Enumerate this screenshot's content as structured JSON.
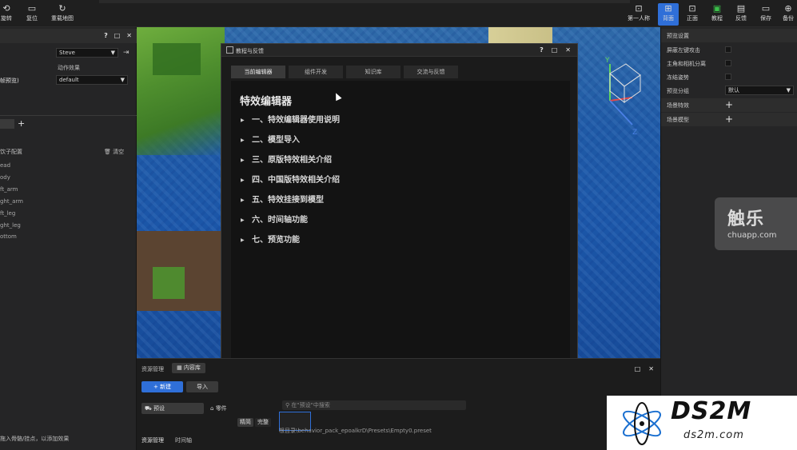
{
  "toolbar": {
    "left_buttons": [
      {
        "label": "旋转",
        "icon": "rotate-icon"
      },
      {
        "label": "复位",
        "icon": "reset-icon"
      },
      {
        "label": "重载地图",
        "icon": "reload-map-icon"
      }
    ],
    "right_buttons": [
      {
        "label": "第一人称",
        "icon": "first-person-icon"
      },
      {
        "label": "背面",
        "icon": "back-view-icon",
        "active": true
      },
      {
        "label": "正面",
        "icon": "front-view-icon"
      },
      {
        "label": "教程",
        "icon": "tutorial-icon"
      },
      {
        "label": "反馈",
        "icon": "feedback-icon"
      },
      {
        "label": "保存",
        "icon": "save-icon"
      },
      {
        "label": "备份",
        "icon": "backup-icon"
      }
    ]
  },
  "left_panel": {
    "controls": [
      "?",
      "□",
      "✕"
    ],
    "model_select": "Steve",
    "anim_effect_label": "动作效果",
    "preview_label": "帧预览)",
    "anim_select": "default",
    "bind_config_label": "饮子配置",
    "clear_label": "清空",
    "bones": [
      "ead",
      "ody",
      "ft_arm",
      "ght_arm",
      "ft_leg",
      "ght_leg",
      "ottom"
    ],
    "hint": "拖入骨骼/挂点，以添加效果"
  },
  "modal": {
    "title": "教程与反馈",
    "controls": [
      "?",
      "□",
      "✕"
    ],
    "tabs": [
      "当前编辑器",
      "组件开发",
      "知识库",
      "交流与反馈"
    ],
    "active_tab": 0,
    "doc_title": "特效编辑器",
    "toc": [
      "一、特效编辑器使用说明",
      "二、模型导入",
      "三、原版特效相关介绍",
      "四、中国版特效相关介绍",
      "五、特效挂接到模型",
      "六、时间轴功能",
      "七、预览功能"
    ]
  },
  "right_panel": {
    "section_title": "预览设置",
    "rows": [
      {
        "label": "屏蔽左键攻击",
        "type": "checkbox"
      },
      {
        "label": "主角和相机分离",
        "type": "checkbox"
      },
      {
        "label": "冻结姿势",
        "type": "checkbox"
      },
      {
        "label": "预览分组",
        "type": "select",
        "value": "默认"
      },
      {
        "label": "场景特效",
        "type": "add"
      },
      {
        "label": "场景模型",
        "type": "add"
      }
    ]
  },
  "bottom_dock": {
    "resource_label": "资源管理",
    "content_lib": "内容库",
    "new_button": "+ 新建",
    "import_button": "导入",
    "preset_item": "预设",
    "part_item": "零件",
    "search_placeholder": "在\"预设\"中搜索",
    "filter_tabs": [
      "精简",
      "完整"
    ],
    "path_text": "根目录\\behavior_pack_epoalkrD\\Presets\\Empty0.preset",
    "bottom_tabs": [
      "资源管理",
      "时间轴"
    ],
    "controls": [
      "□",
      "✕"
    ]
  },
  "gizmo": {
    "y": "Y",
    "x": "X",
    "z": "Z"
  },
  "watermarks": {
    "chuapp_big": "触乐",
    "chuapp_small": "chuapp.com",
    "ds2m_big": "DS2M",
    "ds2m_small": "ds2m.com"
  }
}
